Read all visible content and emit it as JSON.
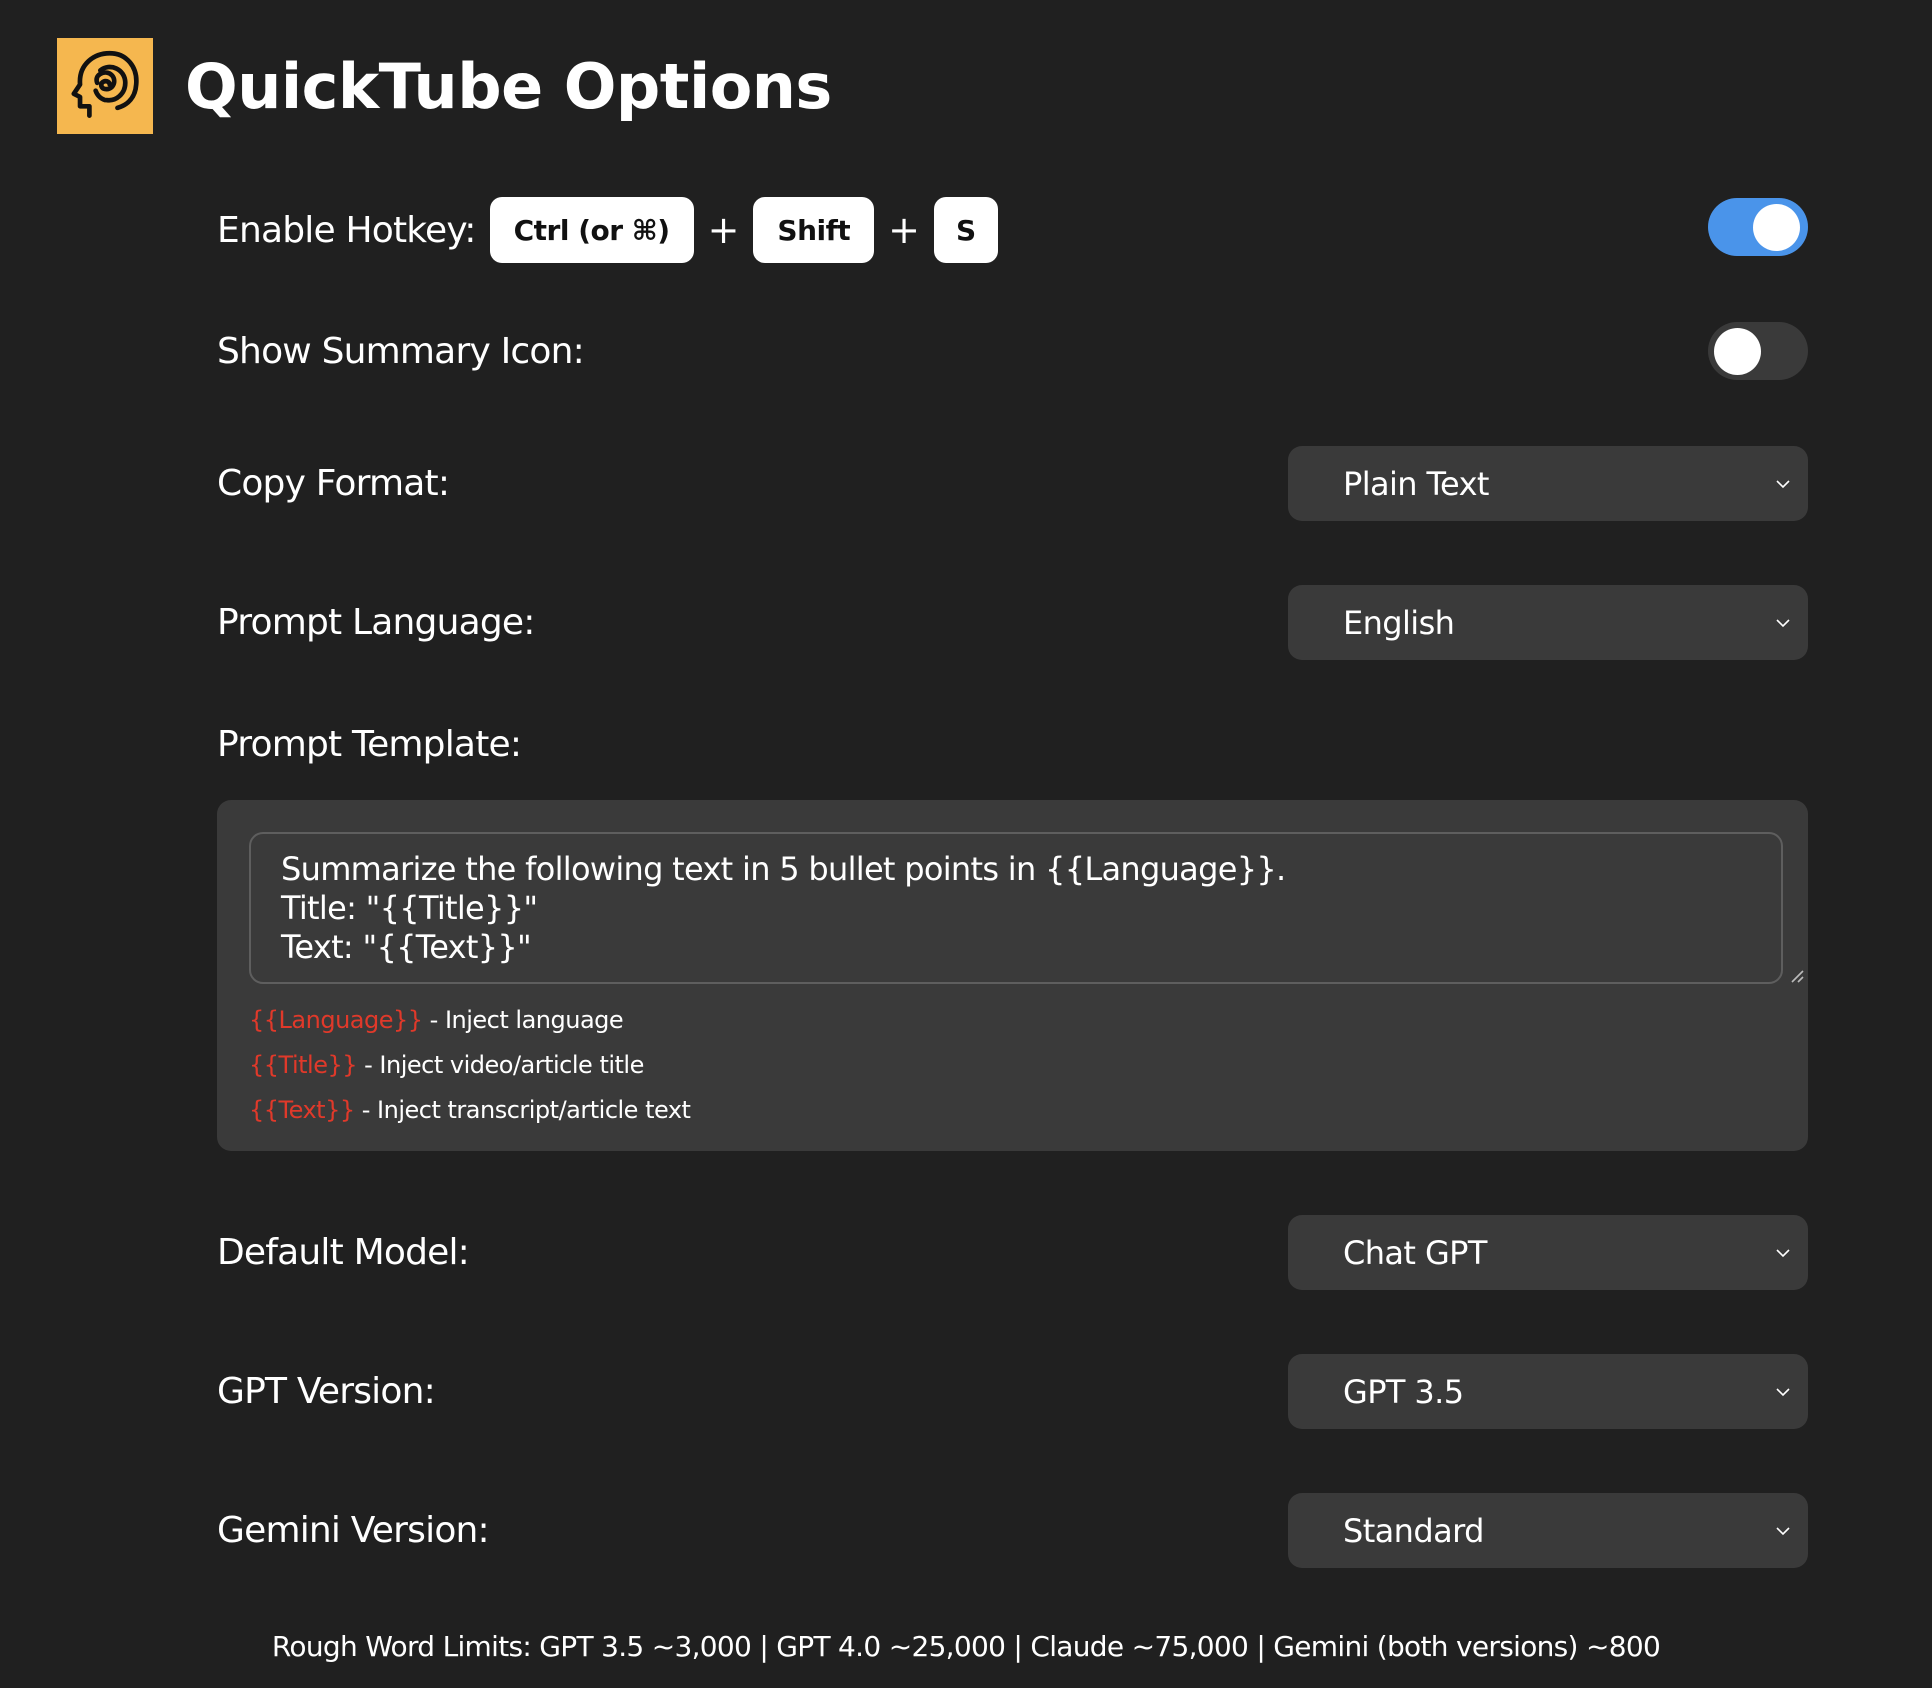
{
  "header": {
    "title": "QuickTube Options",
    "logo_icon": "head-maze-icon",
    "logo_color": "#f5b74f"
  },
  "hotkey": {
    "label": "Enable Hotkey:",
    "keys": [
      "Ctrl (or ⌘)",
      "Shift",
      "S"
    ],
    "separator": "+",
    "enabled": true,
    "toggle_color": "#4a94ea"
  },
  "summary_icon": {
    "label": "Show Summary Icon:",
    "enabled": false
  },
  "copy_format": {
    "label": "Copy Format:",
    "value": "Plain Text"
  },
  "prompt_language": {
    "label": "Prompt Language:",
    "value": "English"
  },
  "prompt_template": {
    "label": "Prompt Template:",
    "value": "Summarize the following text in 5 bullet points in {{Language}}.\nTitle: \"{{Title}}\"\nText: \"{{Text}}\"",
    "hints": [
      {
        "var": "{{Language}}",
        "desc": " - Inject language"
      },
      {
        "var": "{{Title}}",
        "desc": " - Inject video/article title"
      },
      {
        "var": "{{Text}}",
        "desc": " - Inject transcript/article text"
      }
    ],
    "var_color": "#e0392a"
  },
  "default_model": {
    "label": "Default Model:",
    "value": "Chat GPT"
  },
  "gpt_version": {
    "label": "GPT Version:",
    "value": "GPT 3.5"
  },
  "gemini_version": {
    "label": "Gemini Version:",
    "value": "Standard"
  },
  "footer": {
    "text": "Rough Word Limits: GPT 3.5 ~3,000 | GPT 4.0 ~25,000 | Claude ~75,000 | Gemini (both versions) ~800"
  }
}
